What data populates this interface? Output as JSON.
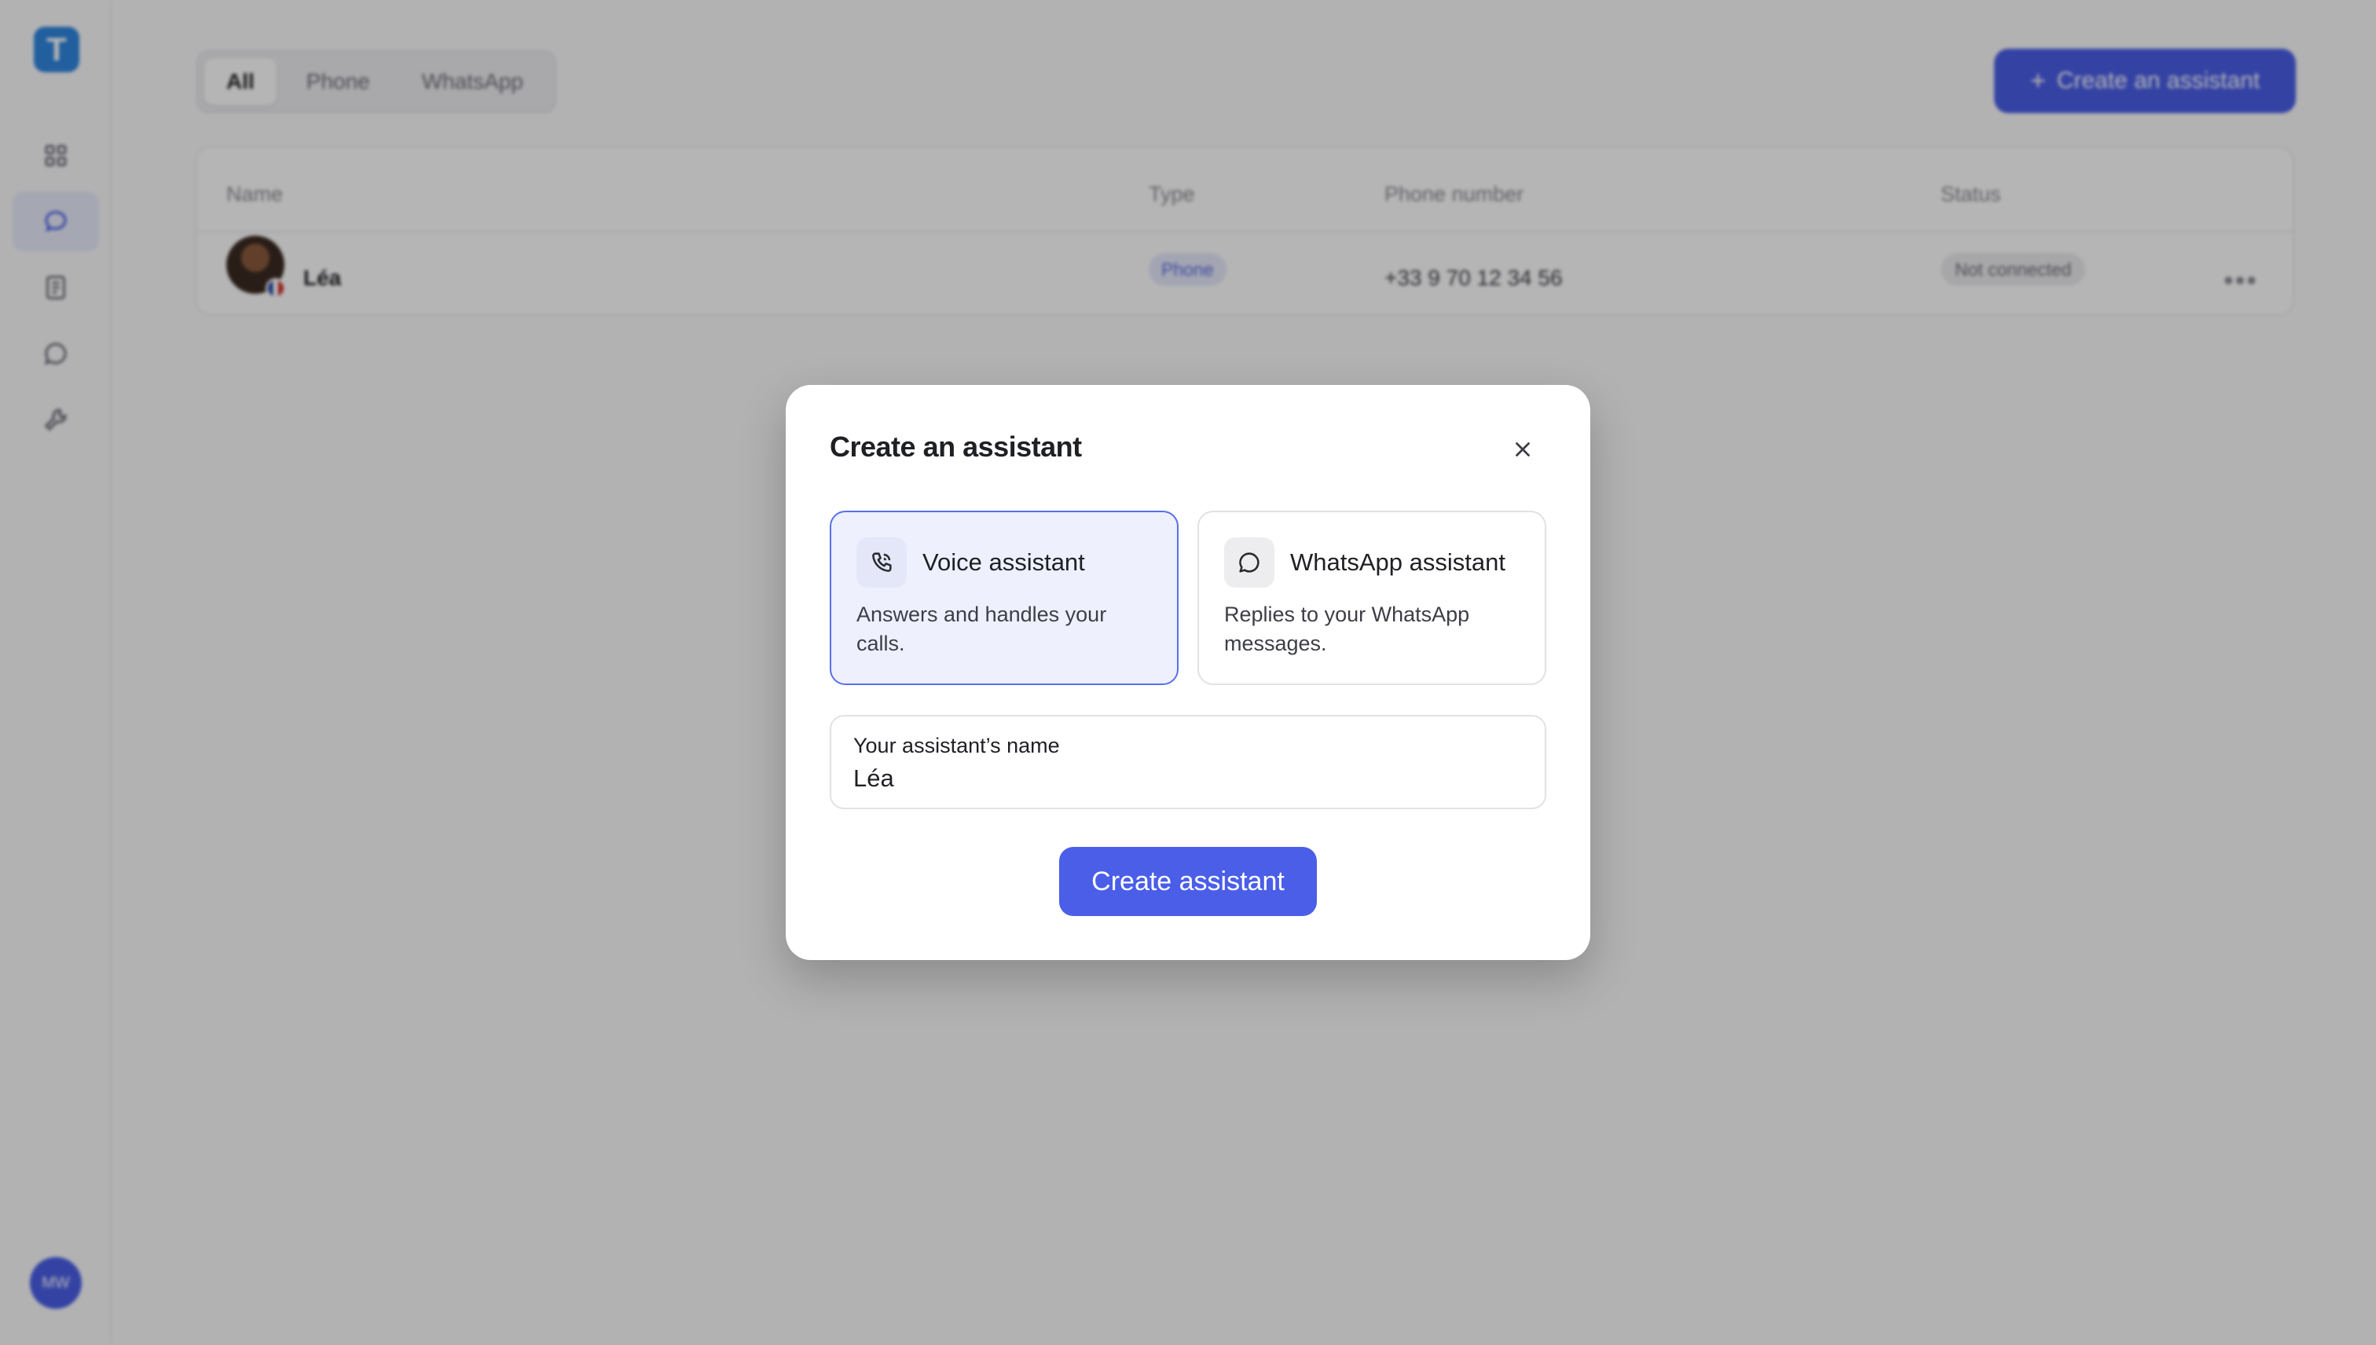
{
  "sidebar": {
    "logo_letter": "T",
    "items": [
      {
        "name": "sidebar-item-dashboard",
        "icon": "grid-icon",
        "active": false
      },
      {
        "name": "sidebar-item-assistants",
        "icon": "chat-bubble-icon",
        "active": true
      },
      {
        "name": "sidebar-item-documents",
        "icon": "document-icon",
        "active": false
      },
      {
        "name": "sidebar-item-conversations",
        "icon": "message-icon",
        "active": false
      },
      {
        "name": "sidebar-item-tools",
        "icon": "wrench-icon",
        "active": false
      }
    ],
    "user_initials": "MW"
  },
  "filters": {
    "tabs": [
      {
        "label": "All",
        "active": true
      },
      {
        "label": "Phone",
        "active": false
      },
      {
        "label": "WhatsApp",
        "active": false
      }
    ]
  },
  "header": {
    "create_button_label": "Create an assistant"
  },
  "table": {
    "columns": {
      "name": "Name",
      "type": "Type",
      "phone": "Phone number",
      "status": "Status"
    },
    "rows": [
      {
        "name": "Léa",
        "type": "Phone",
        "phone": "+33 9 70 12 34 56",
        "status": "Not connected"
      }
    ],
    "more_label": "•••"
  },
  "modal": {
    "title": "Create an assistant",
    "options": [
      {
        "title": "Voice assistant",
        "description": "Answers and handles your calls.",
        "icon": "phone-icon",
        "selected": true
      },
      {
        "title": "WhatsApp assistant",
        "description": "Replies to your WhatsApp messages.",
        "icon": "chat-bubble-icon",
        "selected": false
      }
    ],
    "name_field": {
      "label": "Your assistant’s name",
      "value": "Léa"
    },
    "submit_label": "Create assistant"
  },
  "colors": {
    "accent": "#4a5ee8",
    "selected_border": "#5a6fe6",
    "selected_bg": "#eef0fd",
    "logo_bg": "#2f86e0",
    "overlay": "rgba(0,0,0,0.29)"
  }
}
